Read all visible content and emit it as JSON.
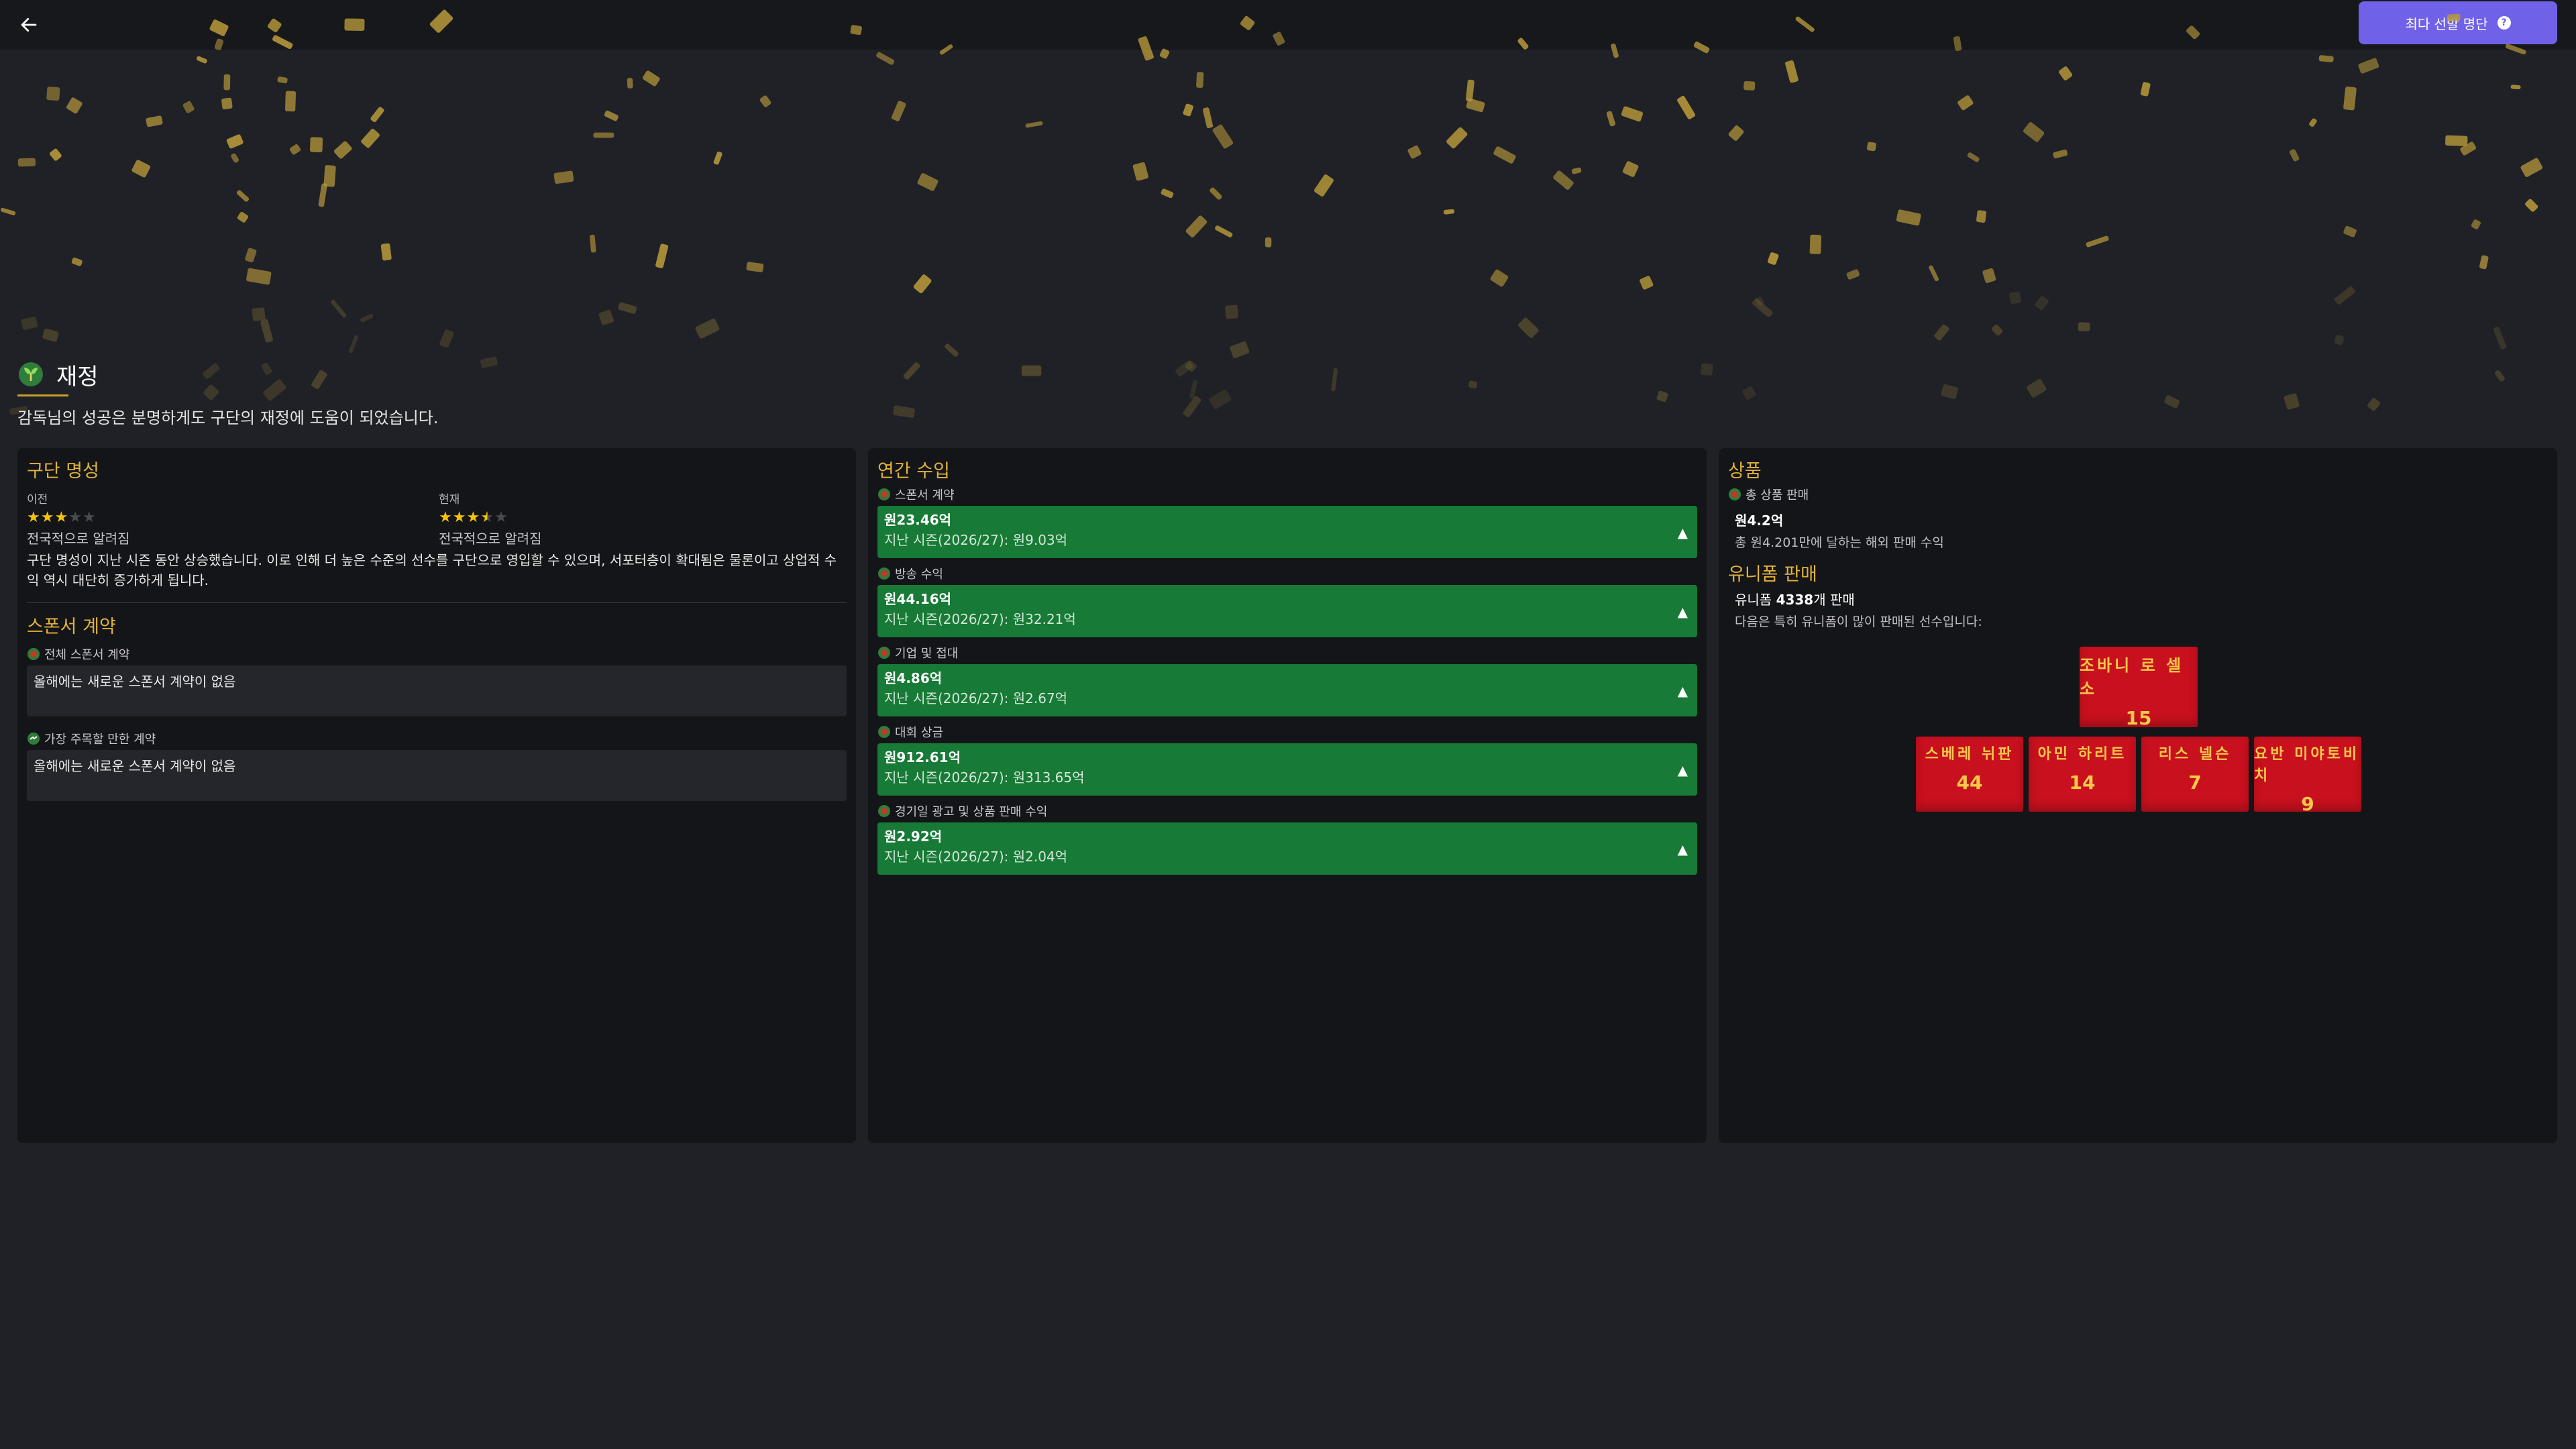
{
  "topbar": {
    "back_icon": "arrow-left-icon",
    "primary_button": {
      "label": "최다 선발 명단",
      "icon": "help-circle-icon"
    }
  },
  "section": {
    "icon": "finance-plant-icon",
    "title": "재정",
    "description": "감독님의 성공은 분명하게도 구단의 재정에 도움이 되었습니다."
  },
  "reputation": {
    "title": "구단 명성",
    "previous": {
      "label": "이전",
      "stars": 3,
      "max": 5,
      "text": "전국적으로 알려짐"
    },
    "current": {
      "label": "현재",
      "stars": 3.5,
      "max": 5,
      "text": "전국적으로 알려짐"
    },
    "description": "구단 명성이 지난 시즌 동안 상승했습니다. 이로 인해 더 높은 수준의 선수를 구단으로 영입할 수 있으며, 서포터층이 확대됨은 물론이고 상업적 수익 역시 대단히 증가하게 됩니다."
  },
  "sponsors": {
    "title": "스폰서 계약",
    "all": {
      "label": "전체 스폰서 계약",
      "text": "올해에는 새로운 스폰서 계약이 없음"
    },
    "notable": {
      "label": "가장 주목할 만한 계약",
      "text": "올해에는 새로운 스폰서 계약이 없음"
    }
  },
  "income": {
    "title": "연간 수입",
    "items": [
      {
        "label": "스폰서 계약",
        "value_prefix": "원",
        "value": "23.46",
        "value_suffix": "억",
        "previous": "지난 시즌(2026/27): 원9.03억",
        "trend": "up"
      },
      {
        "label": "방송 수익",
        "value_prefix": "원",
        "value": "44.16",
        "value_suffix": "억",
        "previous": "지난 시즌(2026/27): 원32.21억",
        "trend": "up"
      },
      {
        "label": "기업 및 접대",
        "value_prefix": "원",
        "value": "4.86",
        "value_suffix": "억",
        "previous": "지난 시즌(2026/27): 원2.67억",
        "trend": "up"
      },
      {
        "label": "대회 상금",
        "value_prefix": "원",
        "value": "912.61",
        "value_suffix": "억",
        "previous": "지난 시즌(2026/27): 원313.65억",
        "trend": "up"
      },
      {
        "label": "경기일 광고 및 상품 판매 수익",
        "value_prefix": "원",
        "value": "2.92",
        "value_suffix": "억",
        "previous": "지난 시즌(2026/27): 원2.04억",
        "trend": "up"
      }
    ]
  },
  "merchandise": {
    "title": "상품",
    "total_label": "총 상품 판매",
    "total_value": "원4.2억",
    "total_sub": "총 원4.201만에 달하는 해외 판매 수익",
    "kit_title": "유니폼 판매",
    "kit_sales_prefix": "유니폼 ",
    "kit_sales_count": "4338",
    "kit_sales_suffix": "개 판매",
    "kit_sub": "다음은 특히 유니폼이 많이 판매된 선수입니다:",
    "shirt_color": "#c8101e",
    "shirt_text_color": "#f7c948",
    "players": [
      {
        "name": "조바니 로 셀소",
        "number": "15"
      },
      {
        "name": "스베레 뉘판",
        "number": "44"
      },
      {
        "name": "아민 하리트",
        "number": "14"
      },
      {
        "name": "리스 넬슨",
        "number": "7"
      },
      {
        "name": "요반 미야토비치",
        "number": "9"
      }
    ]
  }
}
